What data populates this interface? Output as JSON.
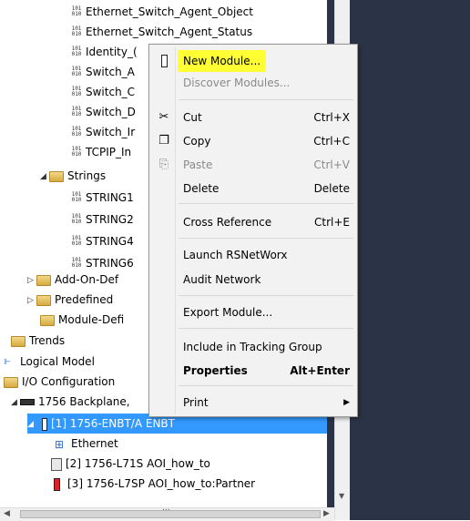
{
  "tree": {
    "items": [
      {
        "label": "Ethernet_Switch_Agent_Object",
        "icon": "binary-tag-icon"
      },
      {
        "label": "Ethernet_Switch_Agent_Status",
        "icon": "binary-tag-icon"
      },
      {
        "label": "Identity_(",
        "icon": "binary-tag-icon"
      },
      {
        "label": "Switch_A",
        "icon": "binary-tag-icon"
      },
      {
        "label": "Switch_C",
        "icon": "binary-tag-icon"
      },
      {
        "label": "Switch_D",
        "icon": "binary-tag-icon"
      },
      {
        "label": "Switch_Ir",
        "icon": "binary-tag-icon"
      },
      {
        "label": "TCPIP_In",
        "icon": "binary-tag-icon"
      },
      {
        "label": "Strings",
        "icon": "folder-icon"
      },
      {
        "label": "STRING1",
        "icon": "binary-tag-icon"
      },
      {
        "label": "STRING2",
        "icon": "binary-tag-icon"
      },
      {
        "label": "STRING4",
        "icon": "binary-tag-icon"
      },
      {
        "label": "STRING6",
        "icon": "binary-tag-icon"
      },
      {
        "label": "Add-On-Def",
        "icon": "folder-icon"
      },
      {
        "label": "Predefined",
        "icon": "folder-icon"
      },
      {
        "label": "Module-Defi",
        "icon": "folder-icon"
      },
      {
        "label": "Trends",
        "icon": "folder-icon"
      },
      {
        "label": "Logical Model",
        "icon": "model-icon"
      },
      {
        "label": "I/O Configuration",
        "icon": "folder-icon"
      },
      {
        "label": "1756 Backplane,",
        "icon": "backplane-icon"
      },
      {
        "label": "[1] 1756-ENBT/A ENBT",
        "icon": "module-icon"
      },
      {
        "label": "Ethernet",
        "icon": "network-icon"
      },
      {
        "label": "[2] 1756-L71S AOI_how_to",
        "icon": "controller-icon"
      },
      {
        "label": "[3] 1756-L7SP AOI_how_to:Partner",
        "icon": "partner-icon"
      }
    ],
    "scroll_thumb_text": "..."
  },
  "menu": {
    "new_module": "New Module...",
    "discover_modules": "Discover Modules...",
    "cut": "Cut",
    "cut_sc": "Ctrl+X",
    "copy": "Copy",
    "copy_sc": "Ctrl+C",
    "paste": "Paste",
    "paste_sc": "Ctrl+V",
    "delete": "Delete",
    "delete_sc": "Delete",
    "cross_reference": "Cross Reference",
    "cross_reference_sc": "Ctrl+E",
    "launch_rsnetworx": "Launch RSNetWorx",
    "audit_network": "Audit Network",
    "export_module": "Export Module...",
    "include_tracking": "Include in Tracking Group",
    "properties": "Properties",
    "properties_sc": "Alt+Enter",
    "print": "Print"
  },
  "colors": {
    "selection": "#3399ff",
    "highlight": "#ffff33",
    "dark_pane": "#2b3447"
  }
}
